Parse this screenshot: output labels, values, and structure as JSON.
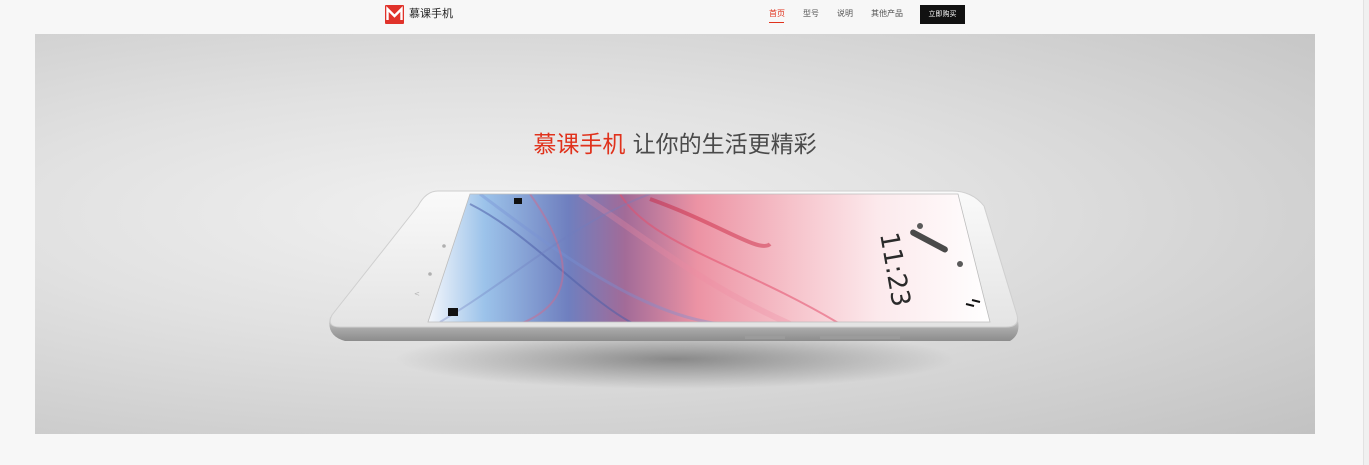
{
  "brand": {
    "name": "慕课手机",
    "logo_color": "#e0322a"
  },
  "nav": {
    "items": [
      {
        "label": "首页",
        "active": true
      },
      {
        "label": "型号",
        "active": false
      },
      {
        "label": "说明",
        "active": false
      },
      {
        "label": "其他产品",
        "active": false
      }
    ],
    "buy_label": "立即购买",
    "active_color": "#e0321c"
  },
  "hero": {
    "slogan_highlight": "慕课手机",
    "slogan_rest": "让你的生活更精彩",
    "phone_time": "11:23"
  }
}
